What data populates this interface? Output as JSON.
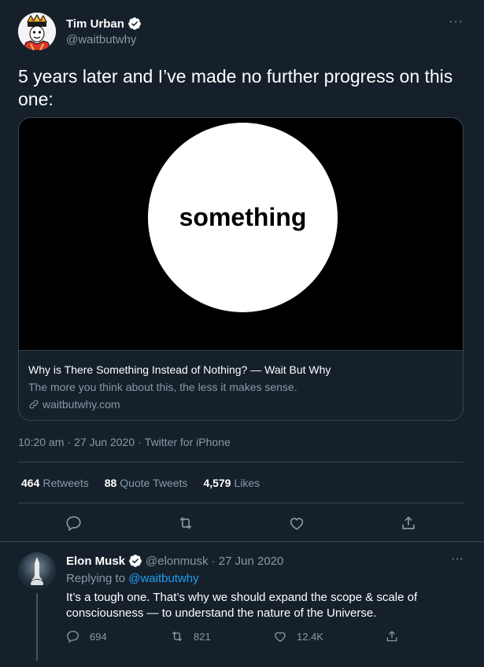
{
  "main_tweet": {
    "author_name": "Tim Urban",
    "author_handle": "@waitbutwhy",
    "more_label": "···",
    "text": "5 years later and I’ve made no further progress on this one:",
    "card": {
      "image_text": "something",
      "title": "Why is There Something Instead of Nothing? — Wait But Why",
      "description": "The more you think about this, the less it makes sense.",
      "domain": "waitbutwhy.com"
    },
    "time": "10:20 am",
    "separator": "·",
    "date": "27 Jun 2020",
    "source": "Twitter for iPhone",
    "stats": {
      "retweets_count": "464",
      "retweets_label": "Retweets",
      "quotes_count": "88",
      "quotes_label": "Quote Tweets",
      "likes_count": "4,579",
      "likes_label": "Likes"
    }
  },
  "reply_tweet": {
    "author_name": "Elon Musk",
    "author_meta": "@elonmusk · 27 Jun 2020",
    "more_label": "···",
    "replying_prefix": "Replying to",
    "replying_handle": "@waitbutwhy",
    "text": "It’s a tough one. That’s why we should expand the scope & scale of consciousness — to understand the nature of the Universe.",
    "reply_count": "694",
    "retweet_count": "821",
    "like_count": "12.4K"
  },
  "colors": {
    "background": "#15202b",
    "secondary_text": "#8899a6",
    "accent": "#1da1f2",
    "border": "#38444d"
  }
}
